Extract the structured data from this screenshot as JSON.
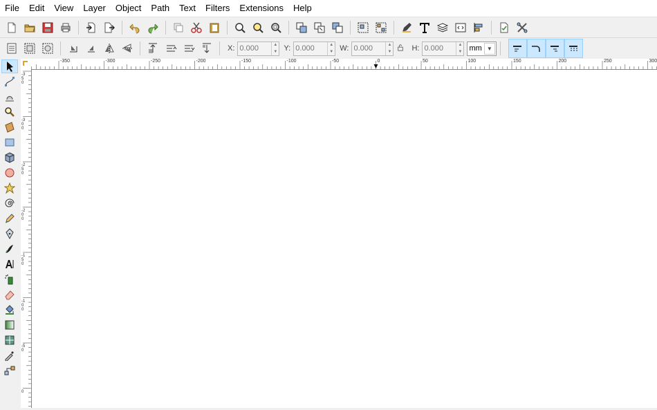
{
  "menubar": {
    "items": [
      {
        "key": "file",
        "label": "File"
      },
      {
        "key": "edit",
        "label": "Edit"
      },
      {
        "key": "view",
        "label": "View"
      },
      {
        "key": "layer",
        "label": "Layer"
      },
      {
        "key": "object",
        "label": "Object"
      },
      {
        "key": "path",
        "label": "Path"
      },
      {
        "key": "text",
        "label": "Text"
      },
      {
        "key": "filters",
        "label": "Filters"
      },
      {
        "key": "extensions",
        "label": "Extensions"
      },
      {
        "key": "help",
        "label": "Help"
      }
    ]
  },
  "controls": {
    "x": {
      "label": "X:",
      "value": "0.000"
    },
    "y": {
      "label": "Y:",
      "value": "0.000"
    },
    "w": {
      "label": "W:",
      "value": "0.000"
    },
    "h": {
      "label": "H:",
      "value": "0.000"
    },
    "lock_icon": "lock-icon",
    "unit": "mm"
  },
  "ruler": {
    "h_labels": [
      "-350",
      "-300",
      "-250",
      "-200",
      "-150",
      "-100",
      "-50",
      "0",
      "50",
      "100",
      "150",
      "200",
      "250",
      "300"
    ],
    "v_labels": [
      "-350",
      "-300",
      "-250",
      "-200",
      "-150",
      "-100",
      "-50",
      "0"
    ]
  },
  "colors": {
    "accent": "#cce8ff",
    "accent_border": "#99d1ff"
  }
}
